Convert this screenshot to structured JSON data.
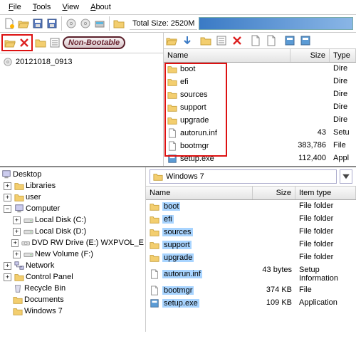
{
  "menu": {
    "file": "File",
    "tools": "Tools",
    "view": "View",
    "about": "About"
  },
  "main_toolbar": {
    "total_size": "Total Size: 2520M"
  },
  "nonboot_label": "Non-Bootable",
  "image_tree": {
    "disc_label": "20121018_0913"
  },
  "top_list": {
    "cols": {
      "name": "Name",
      "size": "Size",
      "type": "Type"
    },
    "rows": [
      {
        "name": "boot",
        "size": "",
        "type": "Dire",
        "icon": "folder"
      },
      {
        "name": "efi",
        "size": "",
        "type": "Dire",
        "icon": "folder"
      },
      {
        "name": "sources",
        "size": "",
        "type": "Dire",
        "icon": "folder"
      },
      {
        "name": "support",
        "size": "",
        "type": "Dire",
        "icon": "folder"
      },
      {
        "name": "upgrade",
        "size": "",
        "type": "Dire",
        "icon": "folder"
      },
      {
        "name": "autorun.inf",
        "size": "43",
        "type": "Setu",
        "icon": "file"
      },
      {
        "name": "bootmgr",
        "size": "383,786",
        "type": "File",
        "icon": "file"
      },
      {
        "name": "setup.exe",
        "size": "112,400",
        "type": "Appl",
        "icon": "app"
      }
    ]
  },
  "tree_nodes": {
    "desktop": "Desktop",
    "libraries": "Libraries",
    "user": "user",
    "computer": "Computer",
    "drive_c": "Local Disk (C:)",
    "drive_d": "Local Disk (D:)",
    "dvd": "DVD RW Drive (E:) WXPVOL_E",
    "drive_f": "New Volume (F:)",
    "network": "Network",
    "control": "Control Panel",
    "recycle": "Recycle Bin",
    "documents": "Documents",
    "win7": "Windows 7"
  },
  "path": {
    "label": "Windows 7"
  },
  "bot_list": {
    "cols": {
      "name": "Name",
      "size": "Size",
      "type": "Item type"
    },
    "rows": [
      {
        "name": "boot",
        "size": "",
        "type": "File folder",
        "icon": "folder"
      },
      {
        "name": "efi",
        "size": "",
        "type": "File folder",
        "icon": "folder"
      },
      {
        "name": "sources",
        "size": "",
        "type": "File folder",
        "icon": "folder"
      },
      {
        "name": "support",
        "size": "",
        "type": "File folder",
        "icon": "folder"
      },
      {
        "name": "upgrade",
        "size": "",
        "type": "File folder",
        "icon": "folder"
      },
      {
        "name": "autorun.inf",
        "size": "43 bytes",
        "type": "Setup Information",
        "icon": "file"
      },
      {
        "name": "bootmgr",
        "size": "374 KB",
        "type": "File",
        "icon": "file"
      },
      {
        "name": "setup.exe",
        "size": "109 KB",
        "type": "Application",
        "icon": "app"
      }
    ]
  }
}
